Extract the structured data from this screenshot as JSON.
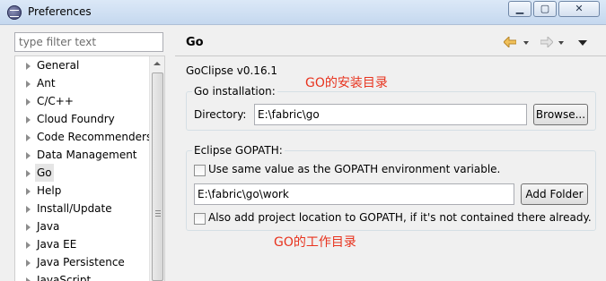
{
  "window": {
    "title": "Preferences",
    "buttons": {
      "minimize": "▁",
      "maximize": "▢",
      "close": "✕"
    }
  },
  "filter": {
    "placeholder": "type filter text",
    "value": ""
  },
  "tree": {
    "items": [
      {
        "label": "General"
      },
      {
        "label": "Ant"
      },
      {
        "label": "C/C++"
      },
      {
        "label": "Cloud Foundry"
      },
      {
        "label": "Code Recommenders"
      },
      {
        "label": "Data Management"
      },
      {
        "label": "Go",
        "selected": true
      },
      {
        "label": "Help"
      },
      {
        "label": "Install/Update"
      },
      {
        "label": "Java"
      },
      {
        "label": "Java EE"
      },
      {
        "label": "Java Persistence"
      },
      {
        "label": "JavaScript"
      }
    ]
  },
  "page": {
    "title": "Go",
    "version": "GoClipse v0.16.1",
    "nav_icons": [
      "back-arrow-icon",
      "forward-arrow-icon",
      "view-menu-icon"
    ]
  },
  "go_installation": {
    "legend": "Go installation:",
    "directory_label": "Directory:",
    "directory_value": "E:\\fabric\\go",
    "browse_label": "Browse..."
  },
  "gopath": {
    "legend": "Eclipse GOPATH:",
    "use_same_label": "Use same value as the GOPATH environment variable.",
    "use_same_checked": false,
    "path_value": "E:\\fabric\\go\\work",
    "add_folder_label": "Add Folder",
    "also_add_label": "Also add project location to GOPATH, if it's not contained there already.",
    "also_add_checked": false
  },
  "annotations": {
    "install_dir": "GO的安装目录",
    "work_dir": "GO的工作目录"
  },
  "colors": {
    "annotation": "#e8331e",
    "titlebar": "#c5d8ef",
    "back_arrow": "#e8b34a"
  }
}
